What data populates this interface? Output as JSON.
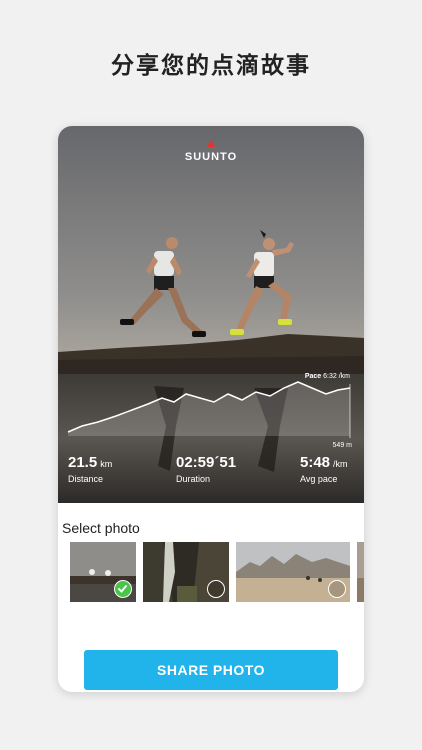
{
  "headline": "分享您的点滴故事",
  "brand": {
    "name": "SUUNTO",
    "logo_accent": "#e4342c"
  },
  "chart_overlay": {
    "pace_label": "Pace",
    "pace_value": "6:32 /km",
    "elevation_label": "549 m"
  },
  "stats": [
    {
      "value": "21.5",
      "unit": "km",
      "label": "Distance"
    },
    {
      "value": "02:59´51",
      "unit": "",
      "label": "Duration"
    },
    {
      "value": "5:48",
      "unit": "/km",
      "label": "Avg pace"
    }
  ],
  "select_photo": {
    "title": "Select photo",
    "thumbnails": [
      {
        "selected": true
      },
      {
        "selected": false
      },
      {
        "selected": false
      },
      {
        "selected": false
      }
    ]
  },
  "share_button": {
    "label": "SHARE PHOTO",
    "color": "#20b4ea"
  }
}
